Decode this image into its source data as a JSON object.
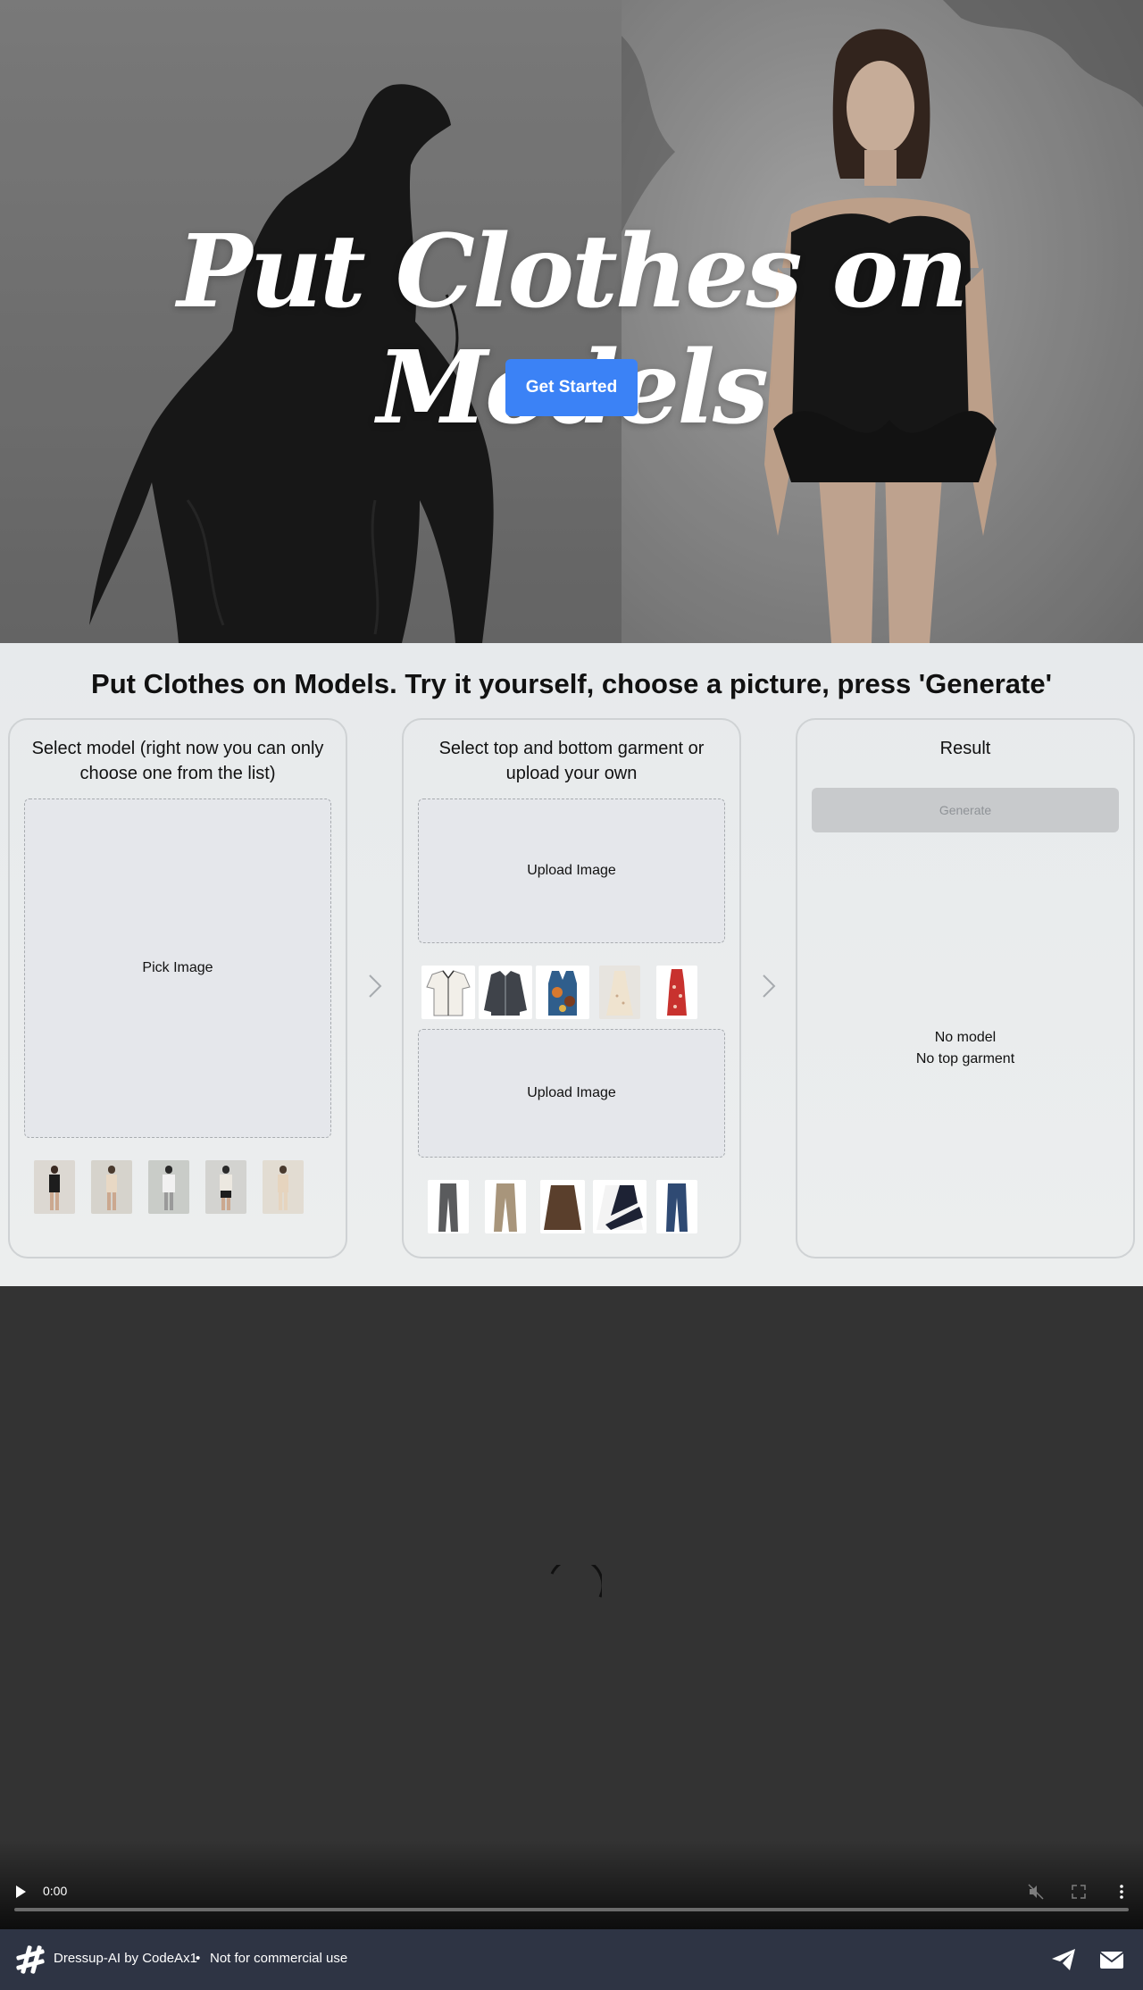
{
  "hero": {
    "title": "Put Clothes on Models",
    "cta_label": "Get Started"
  },
  "demo": {
    "heading": "Put Clothes on Models. Try it yourself, choose a picture, press 'Generate'",
    "model_card": {
      "title": "Select model (right now you can only choose one from the list)",
      "dropzone_label": "Pick Image",
      "thumbnails": [
        "model-1",
        "model-2",
        "model-3",
        "model-4",
        "model-5"
      ]
    },
    "garment_card": {
      "title": "Select top and bottom garment or upload your own",
      "top_dropzone_label": "Upload Image",
      "bottom_dropzone_label": "Upload Image",
      "top_thumbnails": [
        "white-shirt",
        "grey-cardigan",
        "patterned-vest",
        "cream-dress",
        "red-floral-dress"
      ],
      "bottom_thumbnails": [
        "grey-trousers",
        "beige-trousers",
        "brown-leather-skirt",
        "striped-skirt",
        "blue-jeans"
      ]
    },
    "result_card": {
      "title": "Result",
      "generate_label": "Generate",
      "status_model": "No model",
      "status_garment": "No top garment"
    }
  },
  "video": {
    "time": "0:00",
    "progress_fraction": 0
  },
  "footer": {
    "brand": "Dressup-AI by CodeAx1",
    "separator": "•",
    "note": "Not for commercial use"
  },
  "colors": {
    "accent": "#3b82f6",
    "footer_bg": "#2e3444",
    "demo_bg": "#e7eaec",
    "video_bg": "#333333"
  }
}
